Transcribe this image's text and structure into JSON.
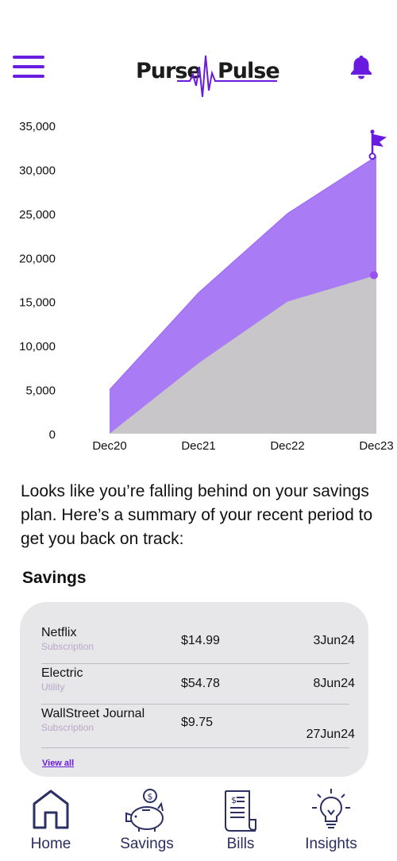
{
  "app": {
    "logo_left": "Purse",
    "logo_right": "Pulse",
    "brand_color": "#6a1be0"
  },
  "header": {
    "menu_icon": "hamburger-menu-icon",
    "bell_icon": "bell-icon"
  },
  "chart_data": {
    "type": "area",
    "categories": [
      "Dec20",
      "Dec21",
      "Dec22",
      "Dec23"
    ],
    "series": [
      {
        "values": [
          5000,
          16000,
          25000,
          31500
        ],
        "color": "#a97cf6"
      },
      {
        "values": [
          0,
          8000,
          15000,
          18000
        ],
        "color": "#c8c6c9"
      }
    ],
    "ylim": [
      0,
      35000
    ],
    "yticks": [
      "0",
      "5,000",
      "10,000",
      "15,000",
      "20,000",
      "25,000",
      "30,000",
      "35,000"
    ],
    "grid": false,
    "goal_marker": "flag-icon",
    "current_marker": "dot"
  },
  "intro_text": "Looks like you’re falling behind on your savings plan. Here’s a summary of your recent period to get you back on track:",
  "savings": {
    "title": "Savings",
    "rows": [
      {
        "name": "Netflix",
        "category": "Subscription",
        "amount": "$14.99",
        "date": "3Jun24"
      },
      {
        "name": "Electric",
        "category": "Utility",
        "amount": "$54.78",
        "date": "8Jun24"
      },
      {
        "name": "WallStreet Journal",
        "category": "Subscription",
        "amount": "$9.75",
        "date": "27Jun24"
      }
    ],
    "view_all": "View all"
  },
  "nav": {
    "items": [
      {
        "label": "Home",
        "icon": "home-icon"
      },
      {
        "label": "Savings",
        "icon": "piggy-bank-icon"
      },
      {
        "label": "Bills",
        "icon": "receipt-icon"
      },
      {
        "label": "Insights",
        "icon": "lightbulb-icon"
      }
    ]
  }
}
